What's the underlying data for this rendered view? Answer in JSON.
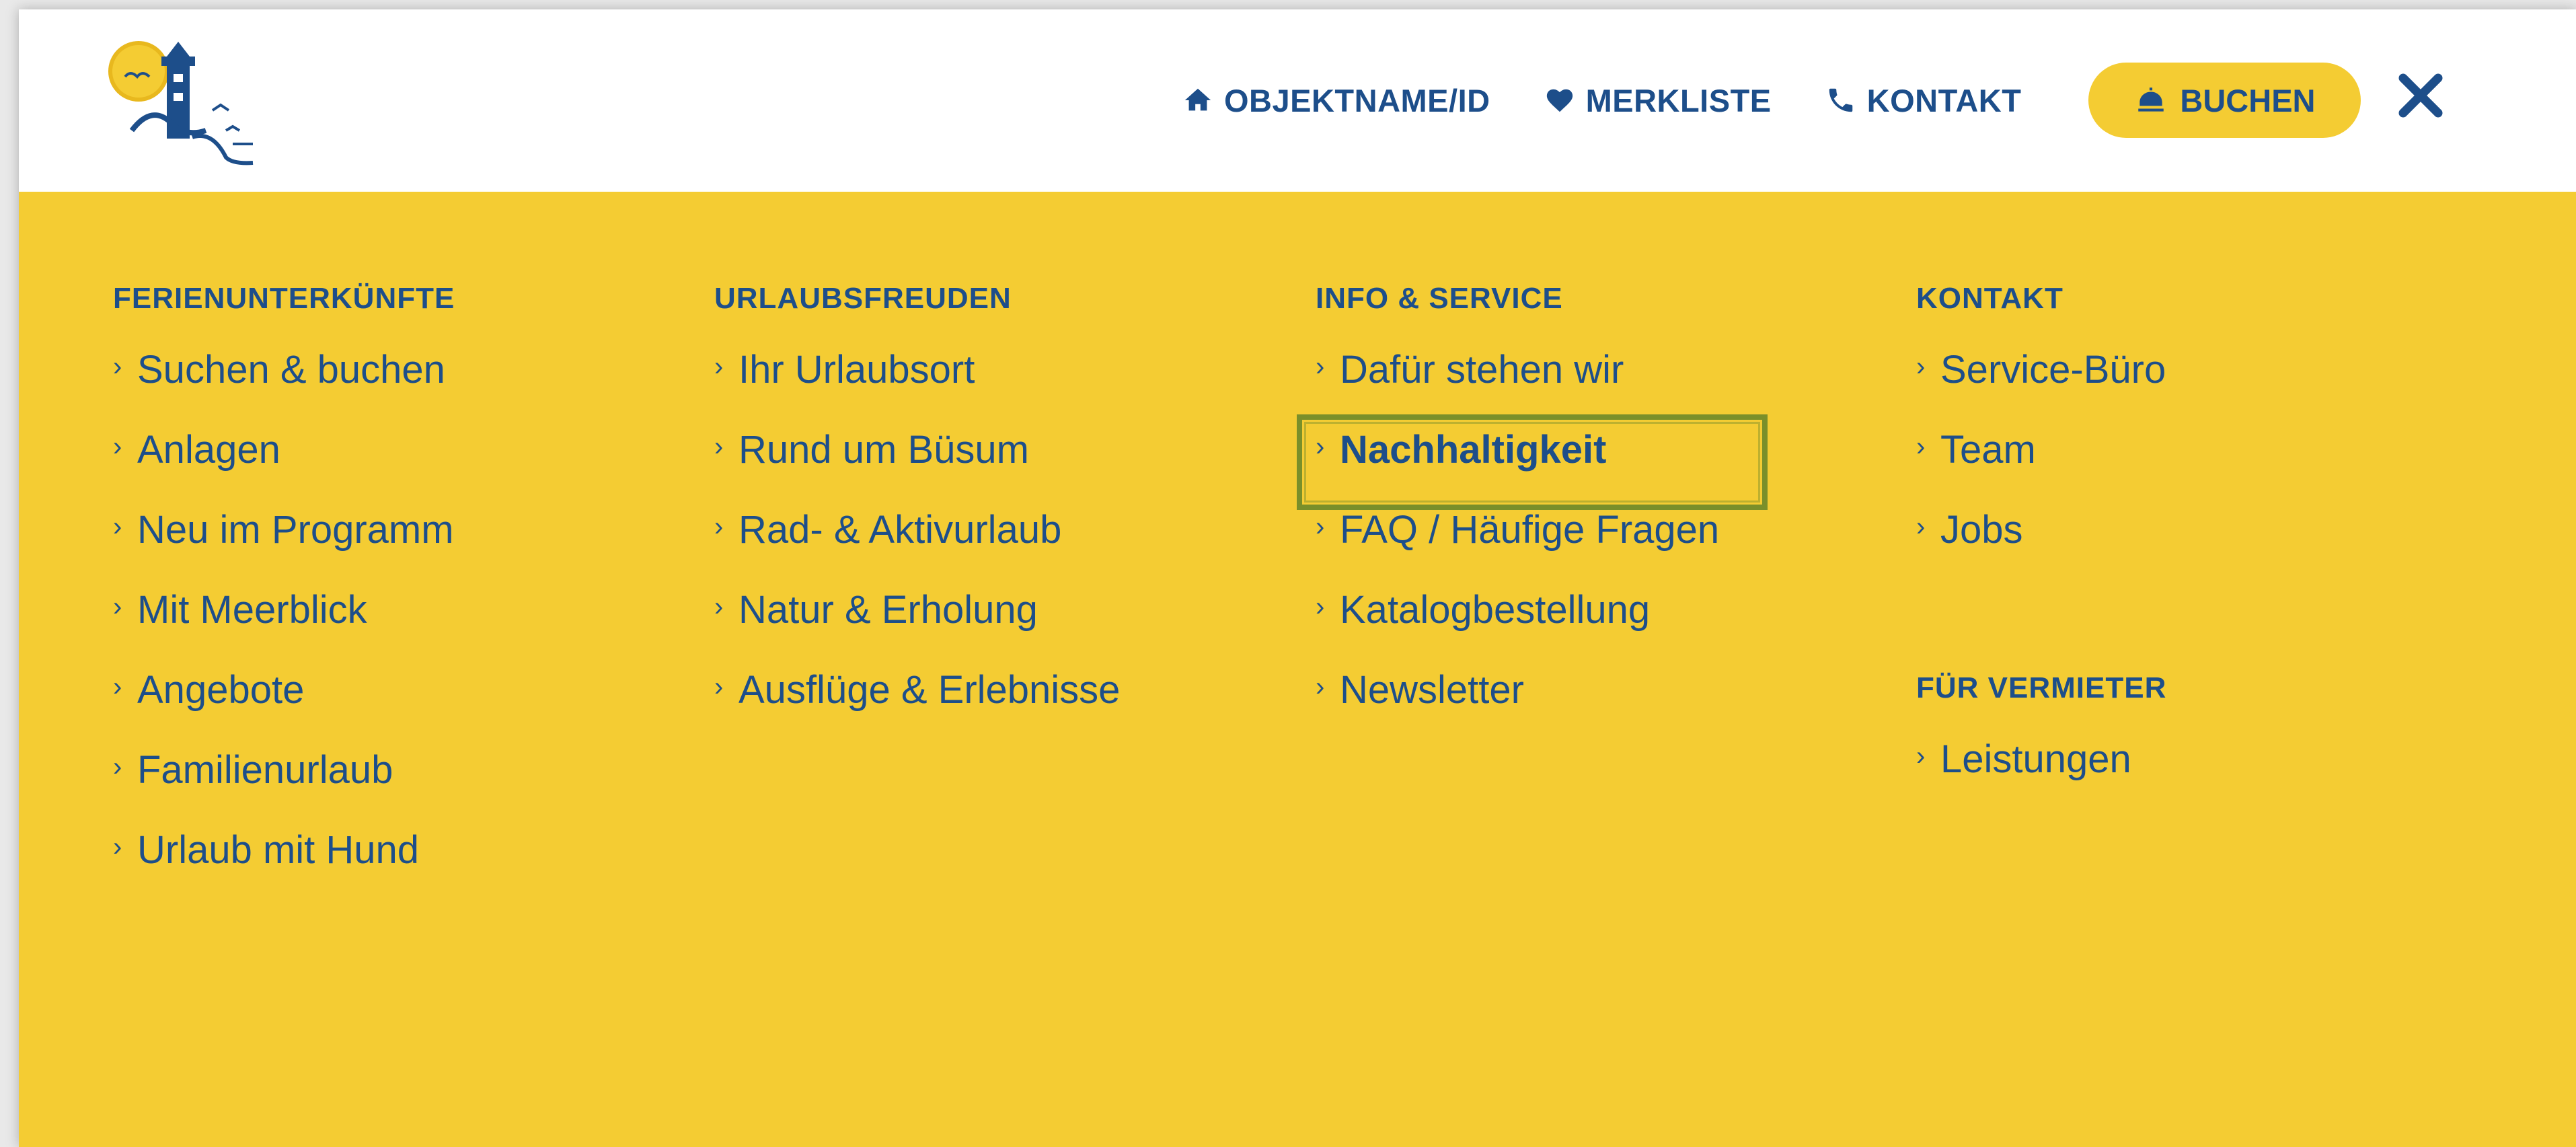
{
  "header": {
    "nav": [
      {
        "label": "Objektname/ID",
        "icon": "home-icon"
      },
      {
        "label": "Merkliste",
        "icon": "heart-icon"
      },
      {
        "label": "Kontakt",
        "icon": "phone-icon"
      }
    ],
    "book_label": "Buchen",
    "book_icon": "service-bell-icon",
    "close_icon": "close-icon"
  },
  "menu": {
    "columns": [
      {
        "heading": "Ferienunterkünfte",
        "items": [
          "Suchen & buchen",
          "Anlagen",
          "Neu im Programm",
          "Mit Meerblick",
          "Angebote",
          "Familienurlaub",
          "Urlaub mit Hund"
        ]
      },
      {
        "heading": "Urlaubsfreuden",
        "items": [
          "Ihr Urlaubsort",
          "Rund um Büsum",
          "Rad- & Aktivurlaub",
          "Natur & Erholung",
          "Ausflüge & Erlebnisse"
        ]
      },
      {
        "heading": "Info & Service",
        "items": [
          "Dafür stehen wir",
          "Nachhaltigkeit",
          "FAQ / Häufige Fragen",
          "Katalogbestellung",
          "Newsletter"
        ],
        "active_item": "Nachhaltigkeit"
      },
      {
        "heading": "Kontakt",
        "items": [
          "Service-Büro",
          "Team",
          "Jobs"
        ]
      },
      {
        "heading": "Für Vermieter",
        "items": [
          "Leistungen"
        ]
      }
    ]
  },
  "colors": {
    "brand_yellow": "#f4cc33",
    "brand_blue": "#1d4e8a",
    "highlight_green": "#7a8f2a",
    "header_bg": "#ffffff"
  }
}
